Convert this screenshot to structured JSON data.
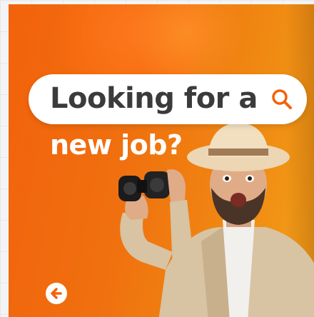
{
  "banner": {
    "search_text": "Looking for a",
    "subheadline": "new job?",
    "icons": {
      "search": "search-icon",
      "back": "arrow-left-icon"
    },
    "colors": {
      "orange": "#f2620c",
      "white": "#ffffff",
      "text_dark": "#3b3b3b"
    }
  }
}
